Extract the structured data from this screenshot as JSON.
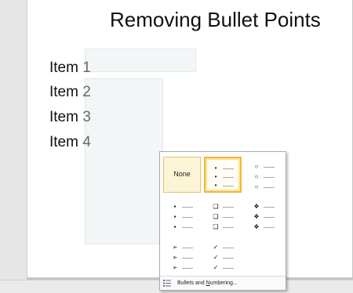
{
  "slide": {
    "title": "Removing Bullet Points",
    "items": [
      {
        "word": "Item",
        "num": "1"
      },
      {
        "word": "Item",
        "num": "2"
      },
      {
        "word": "Item",
        "num": "3"
      },
      {
        "word": "Item",
        "num": "4"
      }
    ]
  },
  "bullet_gallery": {
    "none_label": "None",
    "styles": [
      {
        "id": "none",
        "mark": "",
        "icon": "none"
      },
      {
        "id": "small-dot",
        "mark": "•",
        "icon": "small-dot-bullet-icon"
      },
      {
        "id": "hollow-circle",
        "mark": "○",
        "icon": "hollow-circle-bullet-icon"
      },
      {
        "id": "filled-square",
        "mark": "▪",
        "icon": "filled-square-bullet-icon"
      },
      {
        "id": "hollow-square",
        "mark": "❑",
        "icon": "hollow-square-bullet-icon"
      },
      {
        "id": "diamond-star",
        "mark": "❖",
        "icon": "diamond-star-bullet-icon"
      },
      {
        "id": "arrow",
        "mark": "➢",
        "icon": "arrow-bullet-icon"
      },
      {
        "id": "checkmark",
        "mark": "✓",
        "icon": "checkmark-bullet-icon"
      }
    ],
    "selected": "none",
    "hovered": "small-dot",
    "footer_label_pre": "Bullets and ",
    "footer_label_accel": "N",
    "footer_label_post": "umbering...",
    "footer_icon": "bullets-numbering-icon"
  }
}
